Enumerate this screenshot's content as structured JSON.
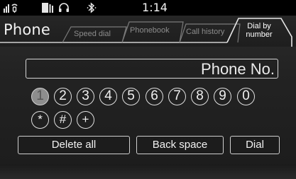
{
  "status_bar": {
    "clock": "1:14",
    "icons": [
      "signal-icon",
      "phone-status-icon",
      "headset-icon",
      "bluetooth-icon"
    ]
  },
  "app": {
    "title": "Phone"
  },
  "tabs": [
    {
      "label": "Speed dial",
      "active": false
    },
    {
      "label": "Phonebook",
      "active": false
    },
    {
      "label": "Call history",
      "active": false
    },
    {
      "label_line1": "Dial by",
      "label_line2": "number",
      "active": true
    }
  ],
  "phone_field": {
    "placeholder": "Phone No.",
    "value": ""
  },
  "keypad": {
    "keys": [
      "1",
      "2",
      "3",
      "4",
      "5",
      "6",
      "7",
      "8",
      "9",
      "0",
      "*",
      "#",
      "+"
    ],
    "highlighted": "1"
  },
  "buttons": {
    "delete_all": "Delete all",
    "back_space": "Back space",
    "dial": "Dial"
  },
  "colors": {
    "background": "#222222",
    "text": "#f2f2f2",
    "inactive_tab_text": "#8c8c8c",
    "highlighted_key": "#8d8d8d"
  }
}
